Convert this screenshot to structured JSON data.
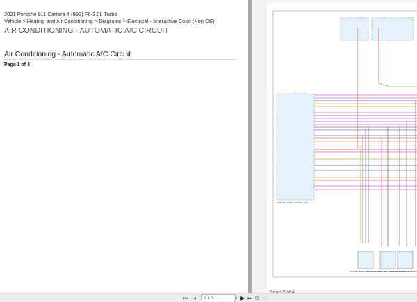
{
  "document": {
    "vehicle": "2021 Porsche 911 Carrera 4 (992) F6-3.0L Turbo",
    "breadcrumb": "Vehicle > Heating and Air Conditioning > Diagrams > Electrical - Interactive Color (Non OE)",
    "heading": "AIR CONDITIONING - AUTOMATIC A/C CIRCUIT",
    "section_title": "Air Conditioning - Automatic A/C Circuit",
    "page_label": "Page 1 of 4"
  },
  "viewer": {
    "next_page_label": "Page 2 of 4",
    "diagram_labels": {
      "control_unit": "ONBOARD SUPPLY CONTROL UNIT",
      "sensor1": "OUTSIDE/HEATER CONTROL SENSOR",
      "sensor2": "LEFT FRONT CHEST VENT TEMPERATURE SENSOR",
      "sensor3": "RIGHT FRONT CHEST VENT TEMPERATURE SENSOR"
    },
    "wire_colors": {
      "red": "#d9534f",
      "pink": "#e066d0",
      "yellow": "#c9b830",
      "blue": "#5a5ad6",
      "gray": "#777",
      "green": "#7ccc55",
      "violet": "#9a6bd6",
      "box_fill": "#e3f1fb"
    }
  },
  "toolbar": {
    "first_icon": "first-page-icon",
    "prev_icon": "prev-page-icon",
    "page_value": "1 / 5",
    "next_icon": "next-page-icon",
    "last_icon": "last-page-icon"
  }
}
